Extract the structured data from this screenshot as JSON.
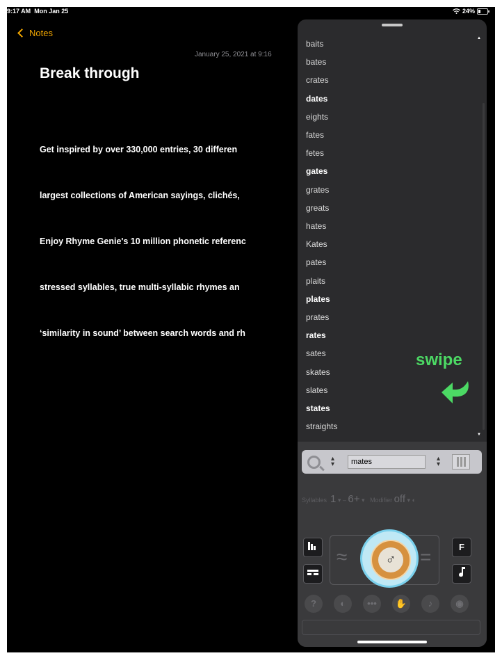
{
  "status_bar": {
    "time": "9:17 AM",
    "date": "Mon Jan 25",
    "battery": "24%",
    "battery_level": 0.24
  },
  "notes": {
    "back_label": "Notes",
    "date": "January 25, 2021 at 9:16",
    "title": "Break through",
    "lines": [
      "Get inspired by over 330,000 entries, 30 differen",
      "largest collections of American sayings, clichés,",
      "Enjoy Rhyme Genie's 10 million phonetic referenc",
      "stressed syllables, true multi-syllabic rhymes an",
      "‘similarity in sound’ between search words and rh"
    ]
  },
  "rhymes": {
    "words": [
      {
        "text": "baits",
        "bold": false
      },
      {
        "text": "bates",
        "bold": false
      },
      {
        "text": "crates",
        "bold": false
      },
      {
        "text": "dates",
        "bold": true
      },
      {
        "text": "eights",
        "bold": false
      },
      {
        "text": "fates",
        "bold": false
      },
      {
        "text": "fetes",
        "bold": false
      },
      {
        "text": "gates",
        "bold": true
      },
      {
        "text": "grates",
        "bold": false
      },
      {
        "text": "greats",
        "bold": false
      },
      {
        "text": "hates",
        "bold": false
      },
      {
        "text": "Kates",
        "bold": false
      },
      {
        "text": "pates",
        "bold": false
      },
      {
        "text": "plaits",
        "bold": false
      },
      {
        "text": "plates",
        "bold": true
      },
      {
        "text": "prates",
        "bold": false
      },
      {
        "text": "rates",
        "bold": true
      },
      {
        "text": "sates",
        "bold": false
      },
      {
        "text": "skates",
        "bold": false
      },
      {
        "text": "slates",
        "bold": false
      },
      {
        "text": "states",
        "bold": true
      },
      {
        "text": "straights",
        "bold": false
      }
    ],
    "swipe_label": "swipe",
    "accent_color": "#4cd964"
  },
  "controls": {
    "search_value": "mates",
    "options": {
      "syllables_label": "Syllables",
      "min": "1",
      "max": "6+",
      "modifier_label": "Modifier",
      "modifier_value": "off"
    },
    "left_buttons": [
      "bar-chart-icon",
      "pattern-icon"
    ],
    "right_buttons": [
      "F",
      "music-note-icon"
    ],
    "dial_symbol": "♂",
    "bottom_icons": [
      "?",
      "toggle-icon",
      "dots-icon",
      "hand-icon",
      "music-icon",
      "eye-icon"
    ]
  }
}
